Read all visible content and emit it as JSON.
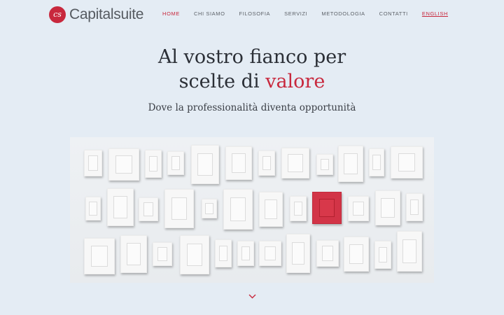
{
  "brand": {
    "mark": "cs",
    "name": "Capitalsuite",
    "accent_color": "#c8283d"
  },
  "nav": {
    "home": "HOME",
    "chi_siamo": "CHI SIAMO",
    "filosofia": "FILOSOFIA",
    "servizi": "SERVIZI",
    "metodologia": "METODOLOGIA",
    "contatti": "CONTATTI",
    "english": "ENGLISH"
  },
  "hero": {
    "title_line1": "Al vostro fianco per",
    "title_line2_prefix": "scelte di ",
    "title_line2_accent": "valore",
    "subtitle": "Dove la professionalità diventa opportunità"
  },
  "gallery": {
    "image_description_icon": "frames-wall-image"
  },
  "scroll": {
    "icon": "chevron-down-icon"
  }
}
